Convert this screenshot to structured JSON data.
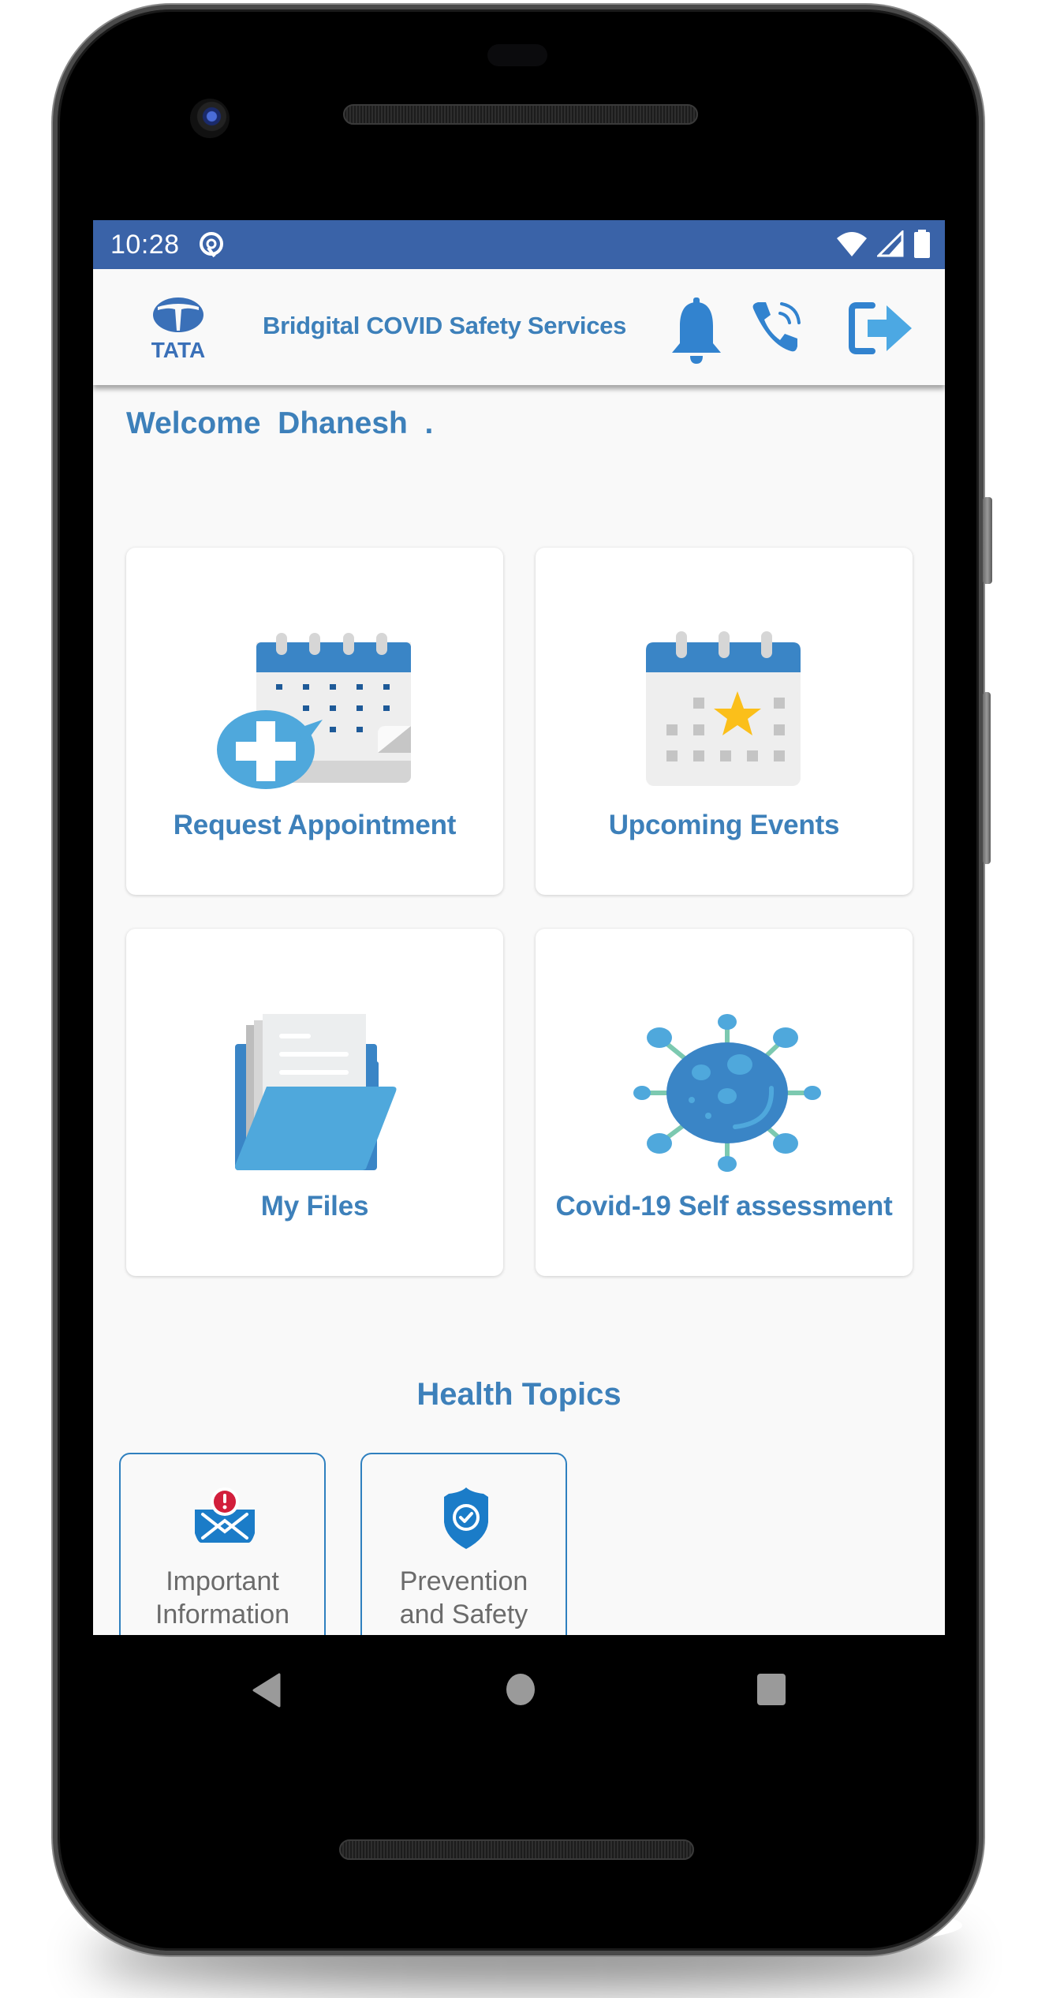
{
  "status_bar": {
    "time": "10:28",
    "icons": [
      "app-notification-icon",
      "wifi-icon",
      "cell-signal-icon",
      "battery-icon"
    ]
  },
  "app_bar": {
    "logo_text": "TATA",
    "title": "Bridgital COVID Safety Services",
    "actions": [
      "bell-icon",
      "phone-call-icon",
      "logout-icon"
    ]
  },
  "welcome": {
    "text": "Welcome  Dhanesh  ."
  },
  "tiles": [
    {
      "label": "Request Appointment",
      "icon": "calendar-add-icon"
    },
    {
      "label": "Upcoming Events",
      "icon": "calendar-star-icon"
    },
    {
      "label": "My Files",
      "icon": "folder-open-icon"
    },
    {
      "label": "Covid-19 Self assessment",
      "icon": "virus-icon"
    }
  ],
  "health_topics": {
    "title": "Health Topics",
    "items": [
      {
        "label_line1": "Important",
        "label_line2": "Information",
        "icon": "mail-alert-icon"
      },
      {
        "label_line1": "Prevention",
        "label_line2": "and Safety",
        "icon": "shield-check-icon"
      }
    ]
  },
  "colors": {
    "status_bar": "#3a63a8",
    "accent": "#3d80ba",
    "icon_blue": "#3a85c6",
    "icon_light_blue": "#4fa8dc",
    "alert_red": "#d21f3c",
    "star_yellow": "#fbbf1a"
  },
  "nav_bar": {
    "buttons": [
      "back",
      "home",
      "recents"
    ]
  }
}
